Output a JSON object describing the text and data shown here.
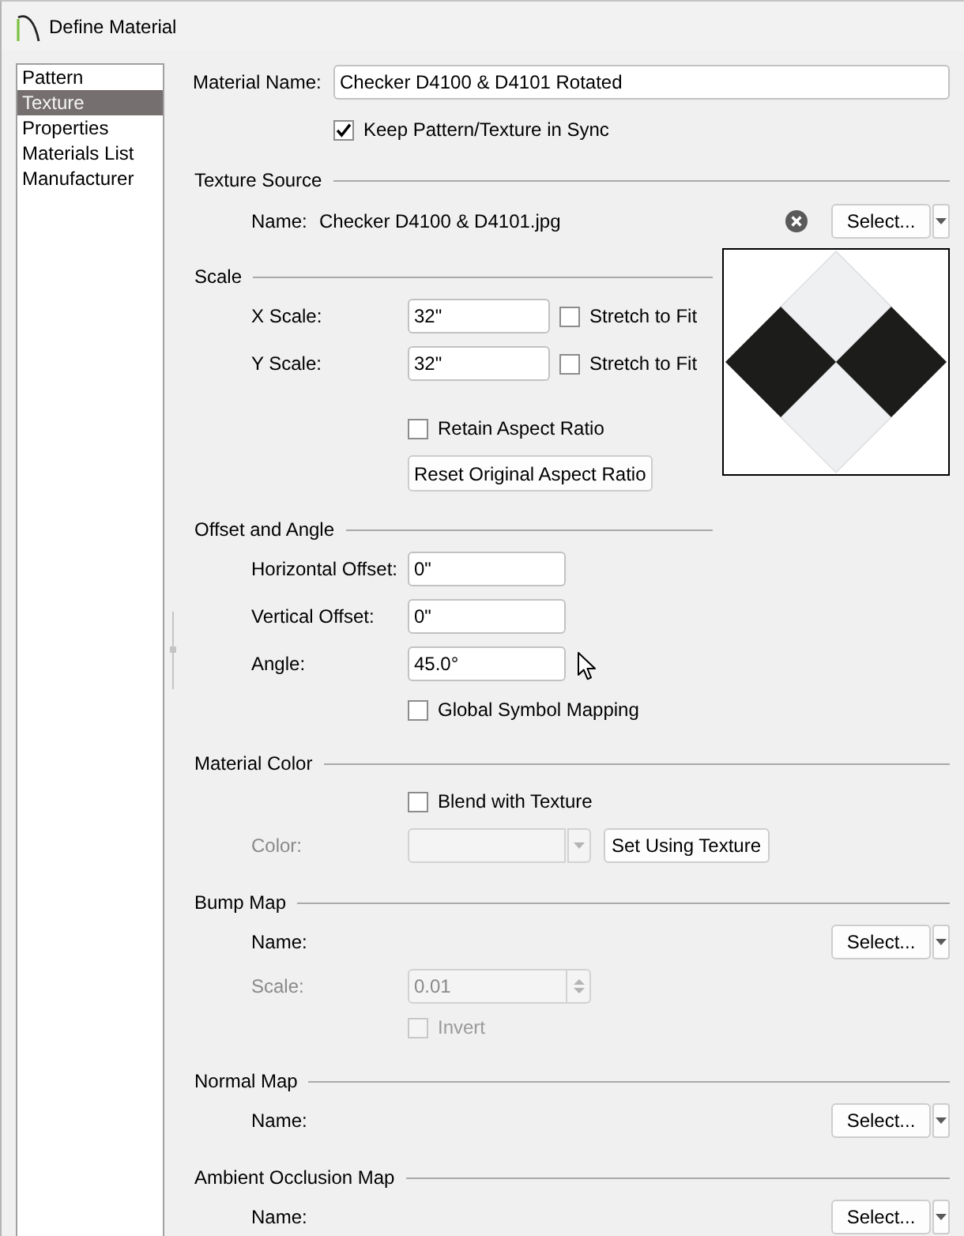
{
  "window": {
    "title": "Define Material"
  },
  "sidebar": {
    "items": [
      {
        "label": "Pattern",
        "selected": false
      },
      {
        "label": "Texture",
        "selected": true
      },
      {
        "label": "Properties",
        "selected": false
      },
      {
        "label": "Materials List",
        "selected": false
      },
      {
        "label": "Manufacturer",
        "selected": false
      }
    ]
  },
  "material_name": {
    "label": "Material Name:",
    "value": "Checker D4100 & D4101 Rotated"
  },
  "keep_in_sync": {
    "label": "Keep Pattern/Texture in Sync",
    "checked": true
  },
  "texture_source": {
    "heading": "Texture Source",
    "name_label": "Name:",
    "file_name": "Checker D4100 & D4101.jpg",
    "select_button": "Select..."
  },
  "scale": {
    "heading": "Scale",
    "rows": [
      {
        "label": "X Scale:",
        "value": "32\"",
        "stretch": {
          "label": "Stretch to Fit",
          "checked": false
        }
      },
      {
        "label": "Y Scale:",
        "value": "32\"",
        "stretch": {
          "label": "Stretch to Fit",
          "checked": false
        }
      }
    ],
    "retain_aspect_ratio": {
      "label": "Retain Aspect Ratio",
      "checked": false
    },
    "reset_button": "Reset Original Aspect Ratio"
  },
  "offset_and_angle": {
    "heading": "Offset and Angle",
    "fields": [
      {
        "label": "Horizontal Offset:",
        "value": "0\""
      },
      {
        "label": "Vertical Offset:",
        "value": "0\""
      },
      {
        "label": "Angle:",
        "value": "45.0°"
      }
    ],
    "global_symbol_mapping": {
      "label": "Global Symbol Mapping",
      "checked": false
    }
  },
  "material_color": {
    "heading": "Material Color",
    "blend_with_texture": {
      "label": "Blend with Texture",
      "checked": false
    },
    "color": {
      "label": "Color:",
      "disabled": true
    },
    "set_button": "Set Using Texture"
  },
  "maps": [
    {
      "heading": "Bump Map",
      "name_label": "Name:",
      "select_button": "Select...",
      "scale": {
        "label": "Scale:",
        "value": "0.01",
        "disabled": true
      },
      "invert": {
        "label": "Invert",
        "checked": false,
        "disabled": true
      }
    },
    {
      "heading": "Normal Map",
      "name_label": "Name:",
      "select_button": "Select..."
    },
    {
      "heading": "Ambient Occlusion Map",
      "name_label": "Name:",
      "select_button": "Select..."
    }
  ]
}
